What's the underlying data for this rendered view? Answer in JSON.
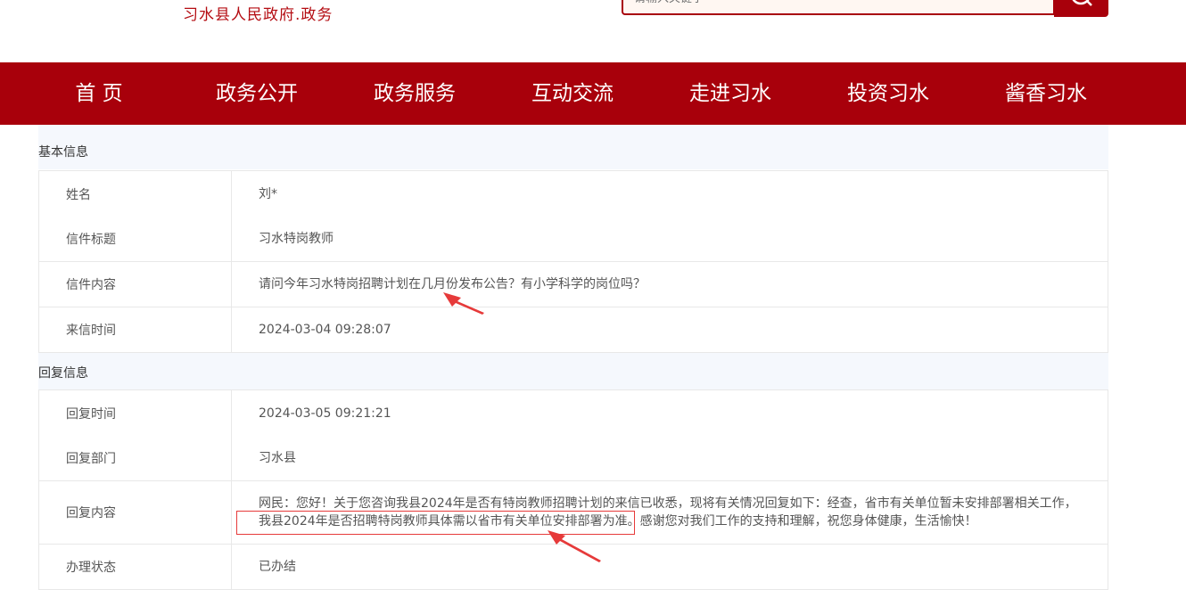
{
  "header": {
    "site_subtitle": "习水县人民政府.政务",
    "search": {
      "placeholder": "请输入关键字"
    }
  },
  "nav": {
    "items": [
      {
        "label": "首 页"
      },
      {
        "label": "政务公开"
      },
      {
        "label": "政务服务"
      },
      {
        "label": "互动交流"
      },
      {
        "label": "走进习水"
      },
      {
        "label": "投资习水"
      },
      {
        "label": "酱香习水"
      }
    ]
  },
  "basic_info": {
    "title": "基本信息",
    "rows": [
      {
        "label": "姓名",
        "value": "刘*"
      },
      {
        "label": "信件标题",
        "value": "习水特岗教师"
      },
      {
        "label": "信件内容",
        "value": "请问今年习水特岗招聘计划在几月份发布公告？有小学科学的岗位吗？"
      },
      {
        "label": "来信时间",
        "value": "2024-03-04 09:28:07"
      }
    ]
  },
  "reply_info": {
    "title": "回复信息",
    "rows": [
      {
        "label": "回复时间",
        "value": "2024-03-05 09:21:21"
      },
      {
        "label": "回复部门",
        "value": "习水县"
      },
      {
        "label": "回复内容",
        "value": "网民：您好！关于您咨询我县2024年是否有特岗教师招聘计划的来信已收悉，现将有关情况回复如下：经查，省市有关单位暂未安排部署相关工作，我县2024年是否招聘特岗教师具体需以省市有关单位安排部署为准。感谢您对我们工作的支持和理解，祝您身体健康，生活愉快！"
      },
      {
        "label": "办理状态",
        "value": "已办结"
      }
    ]
  },
  "colors": {
    "brand_red": "#a8000b",
    "annotation_red": "#e63a3a"
  }
}
